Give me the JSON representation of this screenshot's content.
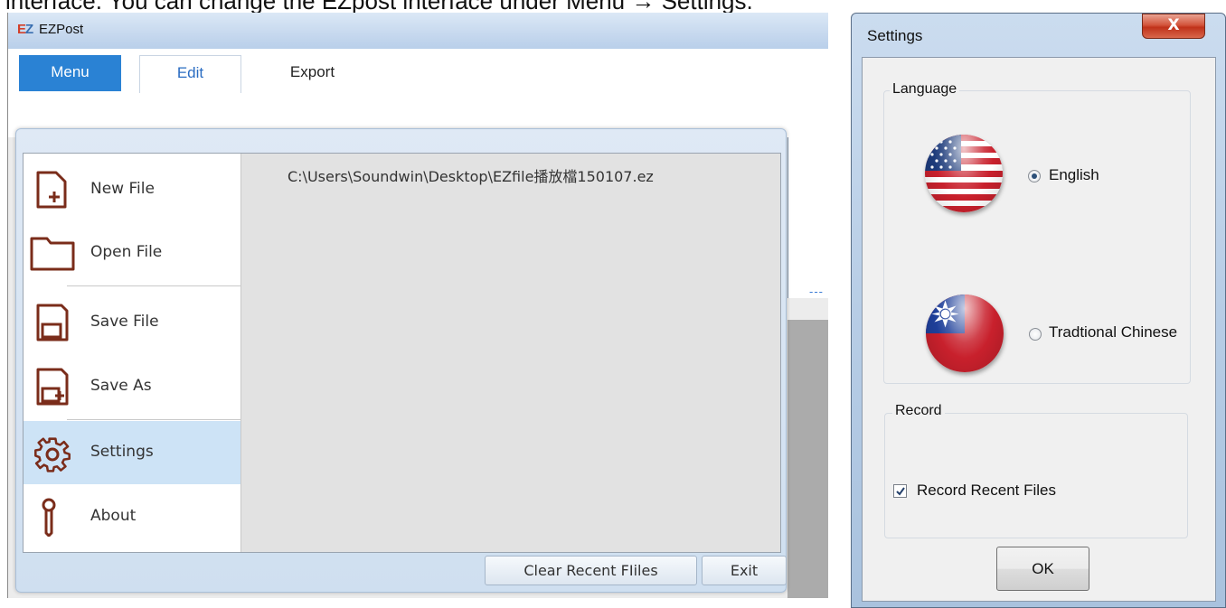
{
  "caption": "interface. You can change the EZpost interface under Menu → Settings.",
  "ezpost": {
    "logo": "EZ",
    "title": "EZPost",
    "tabs": [
      {
        "label": "Menu"
      },
      {
        "label": "Edit"
      },
      {
        "label": "Export"
      }
    ],
    "menu": {
      "items": [
        {
          "label": "New File",
          "icon": "new-file-icon"
        },
        {
          "label": "Open File",
          "icon": "open-file-icon"
        },
        {
          "label": "Save File",
          "icon": "save-file-icon"
        },
        {
          "label": "Save As",
          "icon": "save-as-icon"
        },
        {
          "label": "Settings",
          "icon": "gear-icon"
        },
        {
          "label": "About",
          "icon": "about-icon"
        }
      ],
      "active_item": "Settings",
      "recent_files": [
        "C:\\Users\\Soundwin\\Desktop\\EZfile播放檔150107.ez"
      ],
      "clear_button": "Clear Recent FIiles",
      "exit_button": "Exit"
    },
    "accent_color": "#2a82d4",
    "icon_color": "#7a2c1a"
  },
  "settings_dialog": {
    "title": "Settings",
    "close_label": "X",
    "language_group": {
      "label": "Language",
      "options": [
        {
          "label": "English",
          "selected": true,
          "flag": "us-flag-icon"
        },
        {
          "label": "Tradtional Chinese",
          "selected": false,
          "flag": "taiwan-flag-icon"
        }
      ]
    },
    "record_group": {
      "label": "Record",
      "checkbox_label": "Record Recent Files",
      "checked": true
    },
    "ok_button": "OK"
  }
}
